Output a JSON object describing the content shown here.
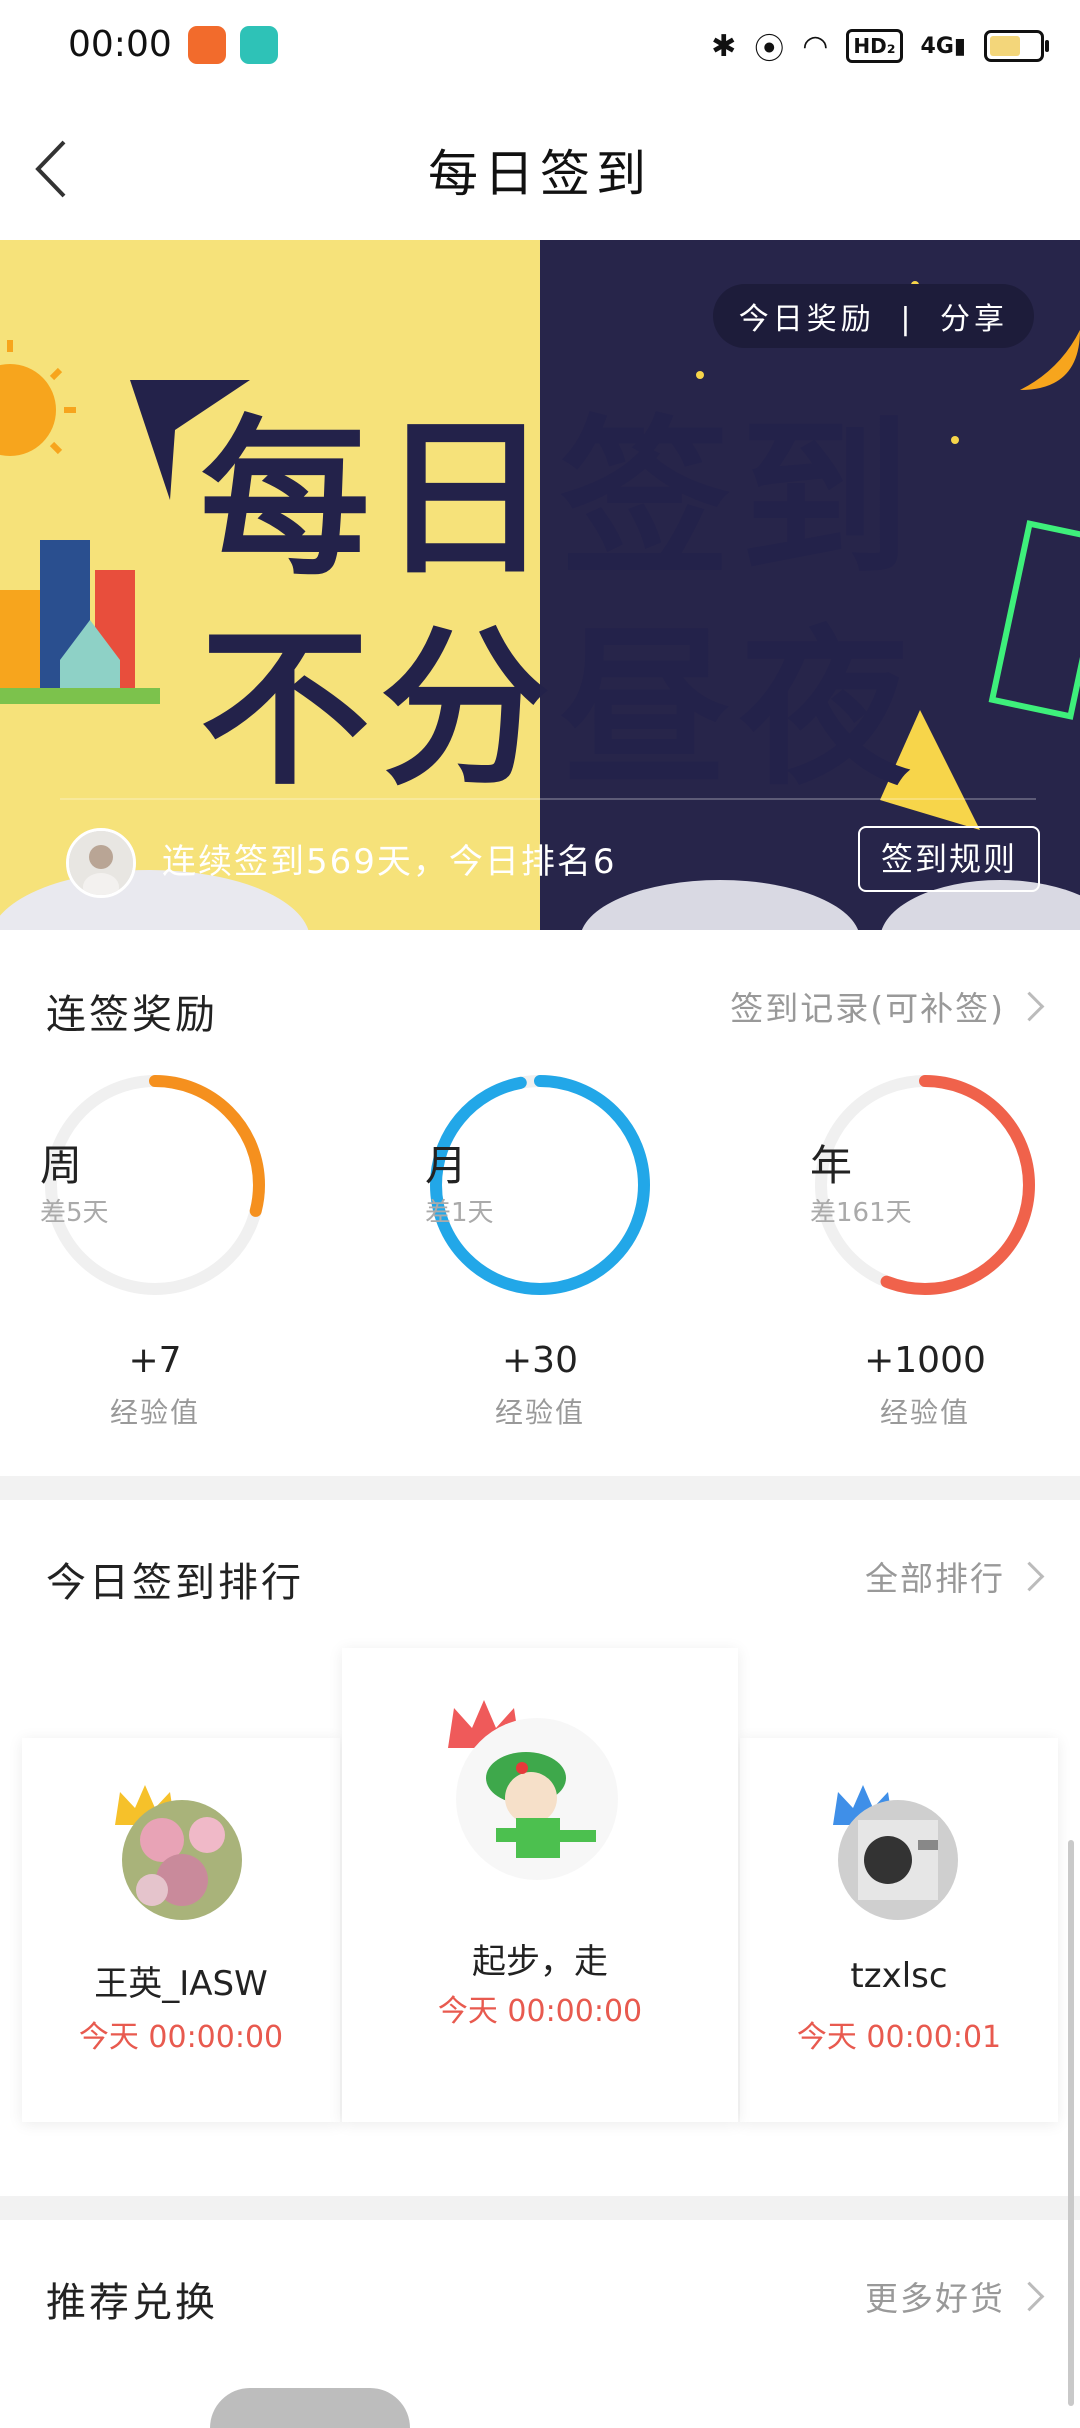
{
  "status_bar": {
    "time": "00:00"
  },
  "nav": {
    "title": "每日签到"
  },
  "banner": {
    "text_line1": "每日签到",
    "text_line2": "不分昼夜",
    "reward_link": "今日奖励",
    "share_link": "分享",
    "separator": "|",
    "streak_text": "连续签到569天，今日排名6",
    "rules_button": "签到规则"
  },
  "streak_rewards": {
    "title": "连签奖励",
    "record_link": "签到记录(可补签)",
    "items": [
      {
        "period": "周",
        "remaining": "差5天",
        "points": "+7",
        "unit": "经验值",
        "progress": 0.29,
        "color": "#f5901e"
      },
      {
        "period": "月",
        "remaining": "差1天",
        "points": "+30",
        "unit": "经验值",
        "progress": 0.97,
        "color": "#22a7e8"
      },
      {
        "period": "年",
        "remaining": "差161天",
        "points": "+1000",
        "unit": "经验值",
        "progress": 0.56,
        "color": "#f0624b"
      }
    ]
  },
  "ranking": {
    "title": "今日签到排行",
    "all_link": "全部排行",
    "entries": [
      {
        "name": "王英_IASW",
        "time": "今天 00:00:00",
        "crown_color": "#f6c12a"
      },
      {
        "name": "起步，走",
        "time": "今天 00:00:00",
        "crown_color": "#ef5a5a"
      },
      {
        "name": "tzxlsc",
        "time": "今天 00:00:01",
        "crown_color": "#3f8fe8"
      }
    ]
  },
  "recommend": {
    "title": "推荐兑换",
    "more_link": "更多好货"
  }
}
